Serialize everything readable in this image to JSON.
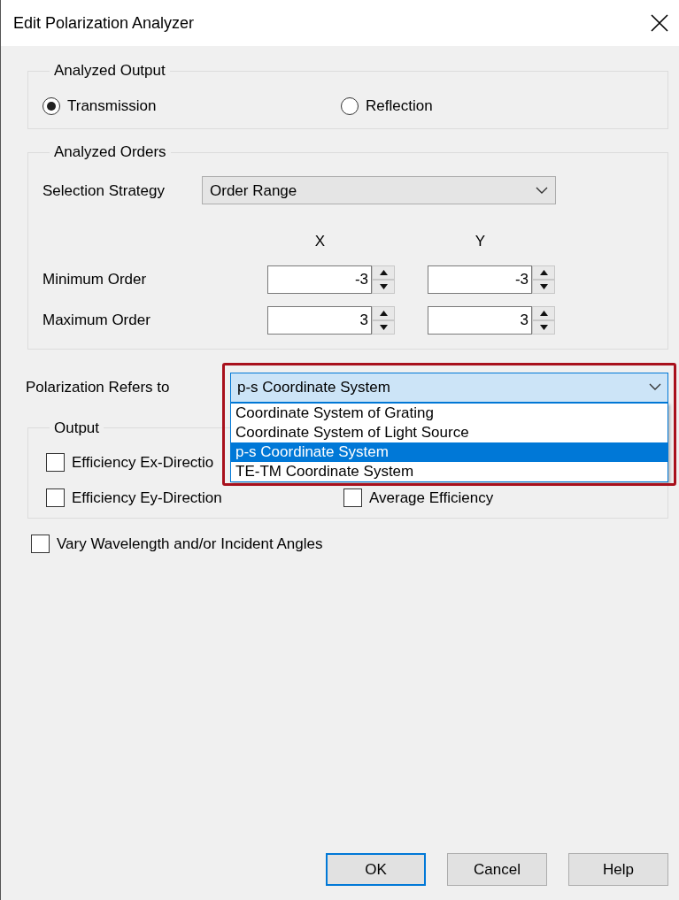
{
  "window": {
    "title": "Edit Polarization Analyzer"
  },
  "analyzed_output": {
    "title": "Analyzed Output",
    "options": [
      {
        "label": "Transmission",
        "selected": true
      },
      {
        "label": "Reflection",
        "selected": false
      }
    ]
  },
  "analyzed_orders": {
    "title": "Analyzed Orders",
    "selection_strategy": {
      "label": "Selection Strategy",
      "value": "Order Range"
    },
    "columns": [
      "X",
      "Y"
    ],
    "rows": [
      {
        "label": "Minimum Order",
        "values": [
          "-3",
          "-3"
        ]
      },
      {
        "label": "Maximum Order",
        "values": [
          "3",
          "3"
        ]
      }
    ]
  },
  "polarization": {
    "label": "Polarization Refers to",
    "value": "p-s Coordinate System",
    "open": true,
    "highlighted": true,
    "options": [
      {
        "label": "Coordinate System of Grating",
        "selected": false
      },
      {
        "label": "Coordinate System of Light Source",
        "selected": false
      },
      {
        "label": "p-s Coordinate System",
        "selected": true
      },
      {
        "label": "TE-TM Coordinate System",
        "selected": false
      }
    ]
  },
  "output": {
    "title": "Output",
    "checkboxes": [
      {
        "label": "Efficiency Ex-Directio",
        "checked": false
      },
      {
        "label": "Efficiency Ey-Direction",
        "checked": false
      },
      {
        "label": "Average Efficiency",
        "checked": false
      }
    ]
  },
  "vary": {
    "label": "Vary Wavelength and/or Incident Angles",
    "checked": false
  },
  "buttons": [
    {
      "label": "OK",
      "default": true
    },
    {
      "label": "Cancel",
      "default": false
    },
    {
      "label": "Help",
      "default": false
    }
  ]
}
